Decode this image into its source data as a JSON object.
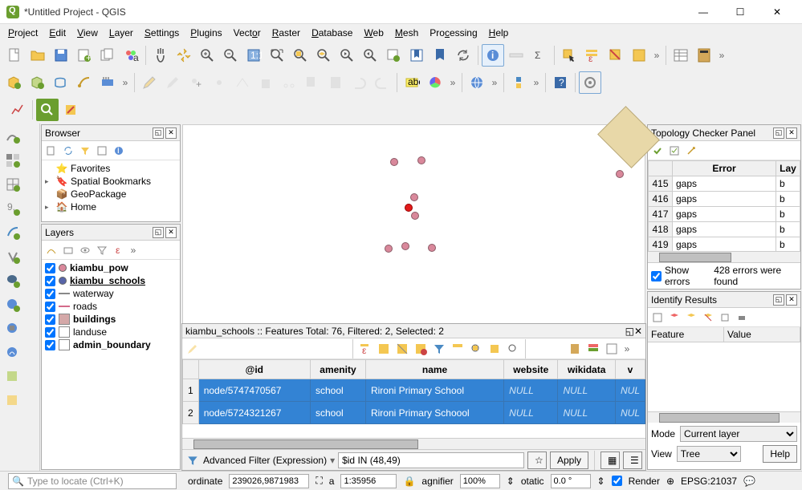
{
  "window": {
    "title": "*Untitled Project - QGIS"
  },
  "menu": [
    "Project",
    "Edit",
    "View",
    "Layer",
    "Settings",
    "Plugins",
    "Vector",
    "Raster",
    "Database",
    "Web",
    "Mesh",
    "Processing",
    "Help"
  ],
  "browser": {
    "title": "Browser",
    "items": [
      {
        "icon": "star",
        "label": "Favorites"
      },
      {
        "icon": "bookmark",
        "label": "Spatial Bookmarks",
        "expandable": true
      },
      {
        "icon": "geopackage",
        "label": "GeoPackage"
      },
      {
        "icon": "home",
        "label": "Home",
        "expandable": true
      }
    ]
  },
  "layers": {
    "title": "Layers",
    "items": [
      {
        "name": "kiambu_pow",
        "sym": "point",
        "color": "#d9889b",
        "checked": true,
        "bold": true
      },
      {
        "name": "kiambu_schools",
        "sym": "point",
        "color": "#5865a8",
        "checked": true,
        "bold": true,
        "active": true
      },
      {
        "name": "waterway",
        "sym": "line",
        "color": "#888",
        "checked": true
      },
      {
        "name": "roads",
        "sym": "line",
        "color": "#d46b8a",
        "checked": true
      },
      {
        "name": "buildings",
        "sym": "fill",
        "color": "#d4a8a8",
        "checked": true,
        "bold": true
      },
      {
        "name": "landuse",
        "sym": "fill",
        "color": "#fff",
        "checked": true
      },
      {
        "name": "admin_boundary",
        "sym": "fill",
        "color": "#fff",
        "checked": true,
        "bold": true
      }
    ]
  },
  "attr": {
    "title": "kiambu_schools :: Features Total: 76, Filtered: 2, Selected: 2",
    "columns": [
      "@id",
      "amenity",
      "name",
      "website",
      "wikidata",
      "v"
    ],
    "rows": [
      {
        "n": 1,
        "id": "node/5747470567",
        "amenity": "school",
        "name": "Rironi Primary School",
        "website": "NULL",
        "wikidata": "NULL",
        "v": "NUL"
      },
      {
        "n": 2,
        "id": "node/5724321267",
        "amenity": "school",
        "name": "Rironi Primary Schoool",
        "website": "NULL",
        "wikidata": "NULL",
        "v": "NUL"
      }
    ],
    "filter_label": "Advanced Filter (Expression)",
    "filter_expr": "$id IN (48,49)",
    "apply": "Apply"
  },
  "topo": {
    "title": "Topology Checker Panel",
    "cols": [
      "Error",
      "Lay"
    ],
    "rows": [
      {
        "n": 415,
        "err": "gaps",
        "lay": "b"
      },
      {
        "n": 416,
        "err": "gaps",
        "lay": "b"
      },
      {
        "n": 417,
        "err": "gaps",
        "lay": "b"
      },
      {
        "n": 418,
        "err": "gaps",
        "lay": "b"
      },
      {
        "n": 419,
        "err": "gaps",
        "lay": "b"
      }
    ],
    "show_errors_label": "Show errors",
    "found_text": "428 errors were found"
  },
  "identify": {
    "title": "Identify Results",
    "cols": [
      "Feature",
      "Value"
    ],
    "mode_label": "Mode",
    "mode_value": "Current layer",
    "view_label": "View",
    "view_value": "Tree",
    "help": "Help"
  },
  "status": {
    "locator_placeholder": "Type to locate (Ctrl+K)",
    "coord_label": "ordinate",
    "coord_value": "239026,9871983",
    "scale_label": "a",
    "scale_value": "1:35956",
    "magnifier_label": "agnifier",
    "magnifier_value": "100%",
    "rotation_label": "otatic",
    "rotation_value": "0.0 °",
    "render_label": "Render",
    "crs": "EPSG:21037"
  },
  "chart_data": {
    "type": "table",
    "title": "kiambu_schools attribute table (filtered)",
    "columns": [
      "@id",
      "amenity",
      "name",
      "website",
      "wikidata"
    ],
    "rows": [
      [
        "node/5747470567",
        "school",
        "Rironi Primary School",
        null,
        null
      ],
      [
        "node/5724321267",
        "school",
        "Rironi Primary Schoool",
        null,
        null
      ]
    ],
    "total_features": 76,
    "filtered": 2,
    "selected": 2
  }
}
